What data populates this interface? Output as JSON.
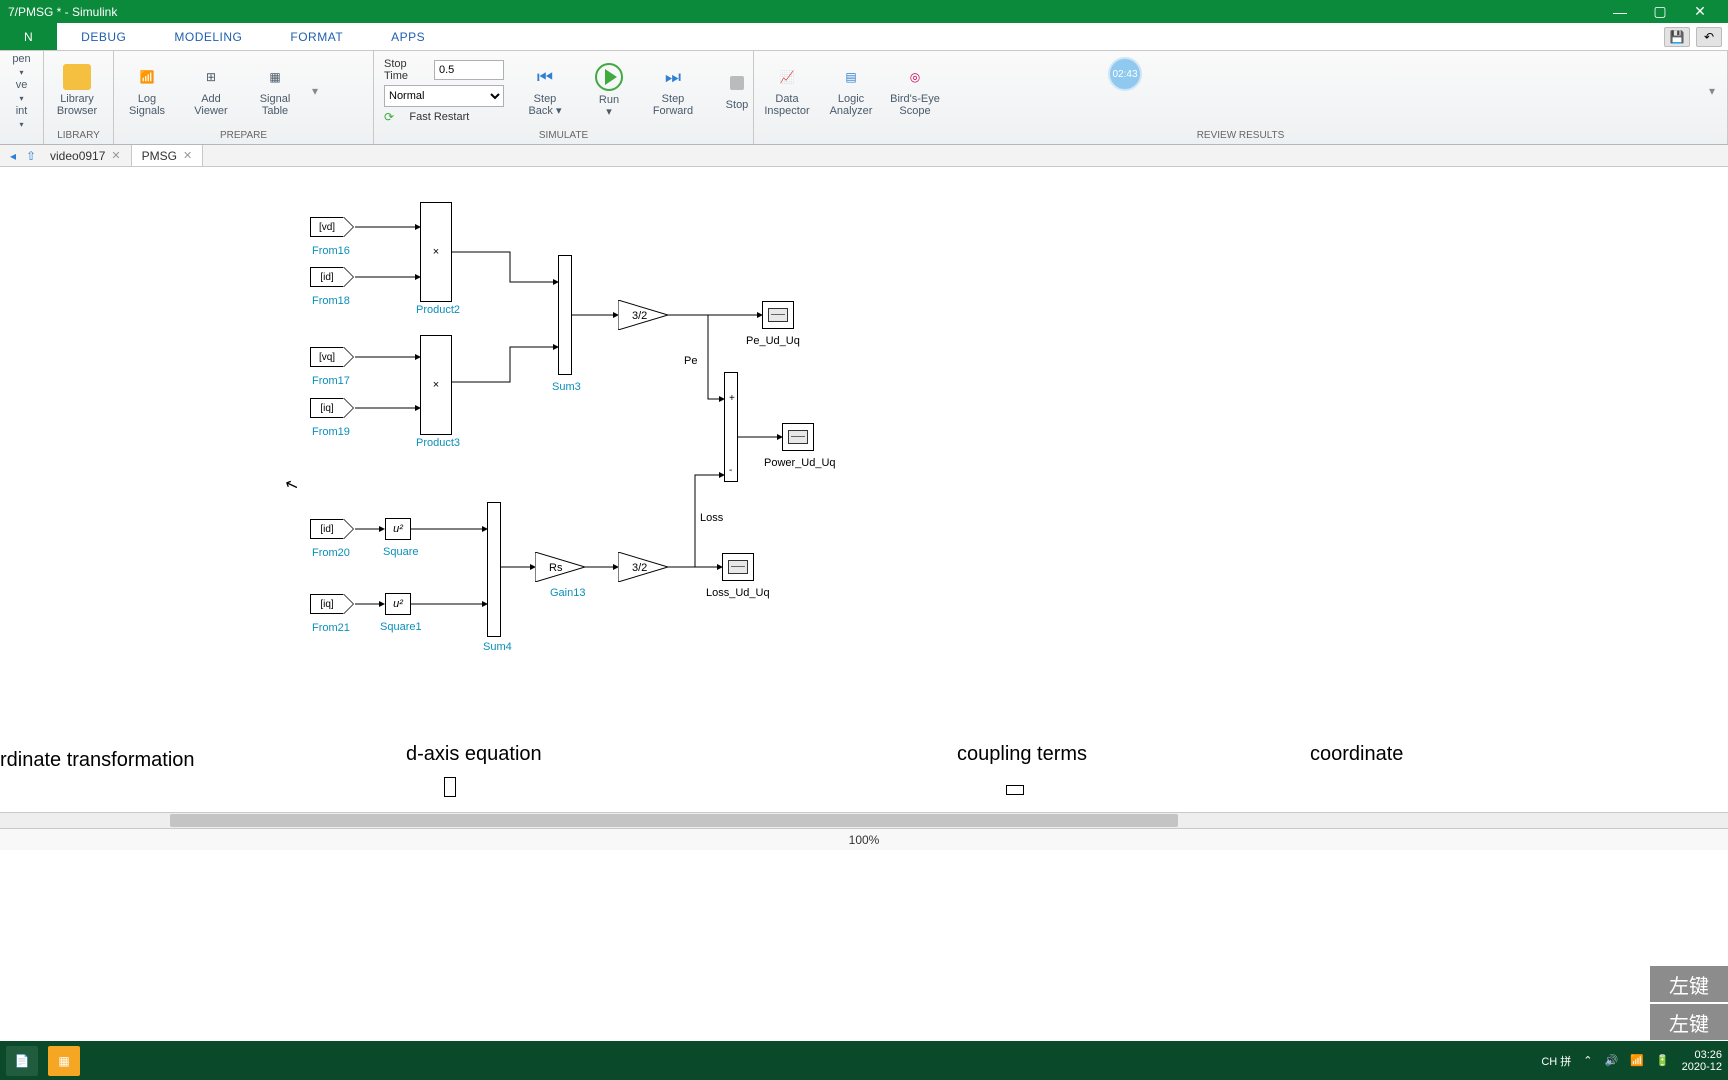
{
  "window": {
    "title": "7/PMSG * - Simulink",
    "min": "—",
    "max": "▢",
    "close": "✕"
  },
  "menu": {
    "tabs": [
      "N",
      "DEBUG",
      "MODELING",
      "FORMAT",
      "APPS"
    ],
    "save_tip": "💾",
    "undo_tip": "↶"
  },
  "ribbon": {
    "file": {
      "open": "pen",
      "save": "ve",
      "print": "int"
    },
    "library": {
      "lib_browser": "Library\nBrowser",
      "label": "LIBRARY"
    },
    "prepare": {
      "log": "Log\nSignals",
      "add": "Add\nViewer",
      "sig": "Signal\nTable",
      "label": "PREPARE"
    },
    "sim": {
      "stop_lbl": "Stop Time",
      "stop_val": "0.5",
      "mode": "Normal",
      "fast": "Fast Restart",
      "step_back": "Step\nBack ▾",
      "run": "Run\n▾",
      "step_fwd": "Step\nForward",
      "stop": "Stop",
      "label": "SIMULATE"
    },
    "review": {
      "di": "Data\nInspector",
      "la": "Logic\nAnalyzer",
      "be": "Bird's-Eye\nScope",
      "label": "REVIEW RESULTS"
    },
    "badge": "02:43"
  },
  "nav": {
    "tab1": "video0917",
    "tab2": "PMSG"
  },
  "blocks": {
    "from16": "[vd]",
    "from16_l": "From16",
    "from18": "[id]",
    "from18_l": "From18",
    "from17": "[vq]",
    "from17_l": "From17",
    "from19": "[iq]",
    "from19_l": "From19",
    "from20": "[id]",
    "from20_l": "From20",
    "from21": "[iq]",
    "from21_l": "From21",
    "prod2": "×",
    "prod2_l": "Product2",
    "prod3": "×",
    "prod3_l": "Product3",
    "sum3_l": "Sum3",
    "sum4_l": "Sum4",
    "gain32a": "3/2",
    "gain32b": "3/2",
    "gainRs": "Rs",
    "gain13_l": "Gain13",
    "sq": "u²",
    "sq_l": "Square",
    "sq1_l": "Square1",
    "pe": "Pe",
    "loss": "Loss",
    "scope1": "Pe_Ud_Uq",
    "scope2": "Power_Ud_Uq",
    "scope3": "Loss_Ud_Uq"
  },
  "annot": {
    "a1": "rdinate transformation",
    "a2": "d-axis equation",
    "a3": "coupling terms",
    "a4": "coordinate"
  },
  "status": {
    "zoom": "100%"
  },
  "taskbar": {
    "ime": "CH 拼",
    "clock": "03:26",
    "date": "2020-12"
  },
  "overlay": {
    "t1": "左键",
    "t2": "左键"
  }
}
